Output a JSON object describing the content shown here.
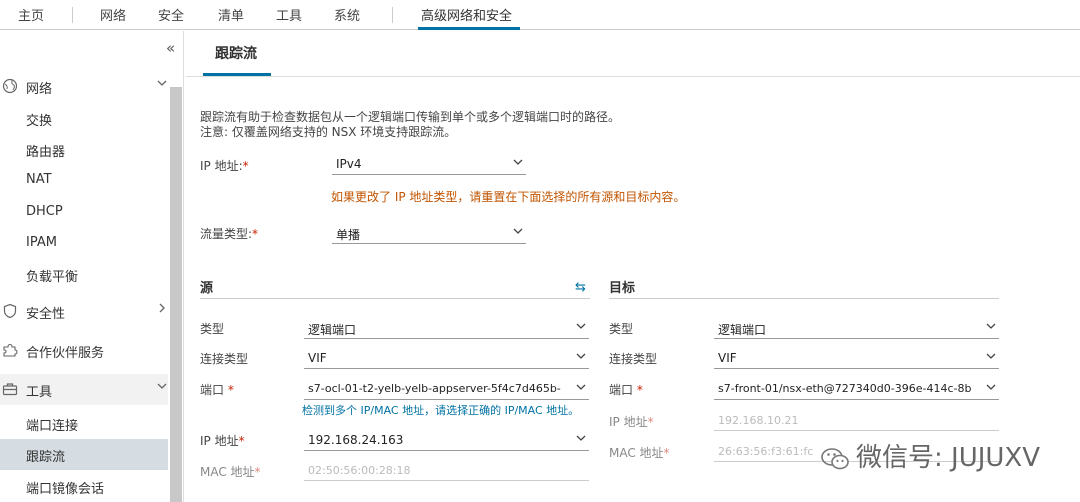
{
  "topnav": {
    "tabs": [
      "主页",
      "网络",
      "安全",
      "清单",
      "工具",
      "系统",
      "高级网络和安全"
    ]
  },
  "sidebar": {
    "collapse_glyph": "«",
    "items": [
      {
        "label": "网络"
      },
      {
        "label": "交换"
      },
      {
        "label": "路由器"
      },
      {
        "label": "NAT"
      },
      {
        "label": "DHCP"
      },
      {
        "label": "IPAM"
      },
      {
        "label": "负载平衡"
      },
      {
        "label": "安全性"
      },
      {
        "label": "合作伙伴服务"
      },
      {
        "label": "工具"
      },
      {
        "label": "端口连接"
      },
      {
        "label": "跟踪流"
      },
      {
        "label": "端口镜像会话"
      }
    ]
  },
  "main": {
    "page_tab": "跟踪流",
    "description_line1": "跟踪流有助于检查数据包从一个逻辑端口传输到单个或多个逻辑端口时的路径。",
    "description_line2": "注意: 仅覆盖网络支持的 NSX 环境支持跟踪流。",
    "ip_label": "IP 地址:",
    "ip_value": "IPv4",
    "ip_warning": "如果更改了 IP 地址类型，请重置在下面选择的所有源和目标内容。",
    "flow_label": "流量类型:",
    "flow_value": "单播",
    "required_mark": "*"
  },
  "source": {
    "title": "源",
    "swap_icon": "⇆",
    "type_label": "类型",
    "type_value": "逻辑端口",
    "conn_label": "连接类型",
    "conn_value": "VIF",
    "port_label": "端口",
    "port_value": "s7-ocl-01-t2-yelb-yelb-appserver-5f4c7d465b-",
    "hint": "检测到多个 IP/MAC 地址，请选择正确的 IP/MAC 地址。",
    "ip_label": "IP 地址",
    "ip_value": "192.168.24.163",
    "mac_label": "MAC 地址",
    "mac_value": "02:50:56:00:28:18"
  },
  "target": {
    "title": "目标",
    "type_label": "类型",
    "type_value": "逻辑端口",
    "conn_label": "连接类型",
    "conn_value": "VIF",
    "port_label": "端口",
    "port_value": "s7-front-01/nsx-eth@727340d0-396e-414c-8b",
    "ip_label": "IP 地址",
    "ip_value": "192.168.10.21",
    "mac_label": "MAC 地址",
    "mac_value": "26:63:56:f3:61:fc"
  },
  "watermark": {
    "text": "微信号: JUJUXV"
  }
}
